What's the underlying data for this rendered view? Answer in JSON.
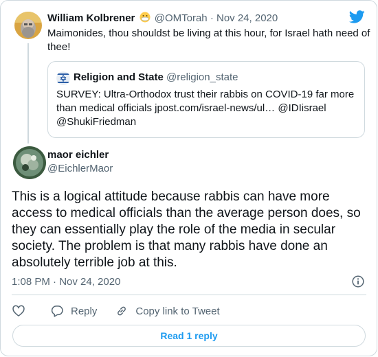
{
  "parent_tweet": {
    "author_name": "William Kolbrener",
    "author_emoji": "mask-face-emoji",
    "handle": "@OMTorah",
    "separator": "·",
    "date": "Nov 24, 2020",
    "text": "Maimonides, thou shouldst be living at this hour, for Israel hath need of thee!"
  },
  "quoted_tweet": {
    "author_name": "Religion and State",
    "handle": "@religion_state",
    "text": "SURVEY: Ultra-Orthodox trust their rabbis on COVID-19 far more than medical officials jpost.com/israel-news/ul… @IDIisrael @ShukiFriedman"
  },
  "main_tweet": {
    "author_name": "maor eichler",
    "handle": "@EichlerMaor",
    "text": "This is a logical attitude because rabbis can have more access to medical officials than the average person does, so they can essentially play the role of the media in secular society. The problem is that many rabbis have done an absolutely terrible job at this.",
    "timestamp": "1:08 PM · Nov 24, 2020"
  },
  "actions": {
    "like_label": "",
    "reply_label": "Reply",
    "copy_label": "Copy link to Tweet"
  },
  "read_replies_label": "Read 1 reply",
  "colors": {
    "accent": "#1d9bf0",
    "text": "#0f1419",
    "secondary": "#536471",
    "border": "#cfd9de"
  },
  "icons": [
    "twitter-bird-icon",
    "info-icon",
    "heart-icon",
    "reply-icon",
    "link-icon",
    "star-of-david-icon"
  ]
}
